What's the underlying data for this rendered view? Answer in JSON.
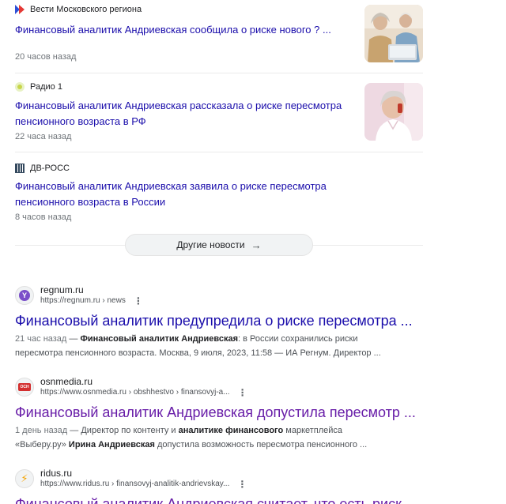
{
  "news": [
    {
      "source": "Вести Московского региона",
      "source_icon": "vesti-logo-icon",
      "title": "Финансовый аналитик Андриевская сообщила о риске нового ? ...",
      "time": "20 часов назад",
      "thumbnail": "elderly-couple-laptop-photo"
    },
    {
      "source": "Радио 1",
      "source_icon": "radio1-logo-icon",
      "title": "Финансовый аналитик Андриевская рассказала о риске пересмотра пенсионного возраста в РФ",
      "time": "22 часа назад",
      "thumbnail": "elderly-woman-phone-photo"
    },
    {
      "source": "ДВ-РОСС",
      "source_icon": "dvross-logo-icon",
      "title": "Финансовый аналитик Андриевская заявила о риске пересмотра пенсионного возраста в России",
      "time": "8 часов назад"
    }
  ],
  "more_news": {
    "label": "Другие новости",
    "icon": "arrow-right-icon"
  },
  "results": [
    {
      "site": "regnum.ru",
      "url": "https://regnum.ru › news",
      "title": "Финансовый аналитик предупредила о риске пересмотра ...",
      "date": "21 час назад",
      "dash": " — ",
      "bold1": "Финансовый аналитик Андриевская",
      "text1": ": в России сохранились риски пересмотра пенсионного возраста. Москва, 9 июля, 2023, 11:58 — ИА Регнум. Директор ..."
    },
    {
      "site": "osnmedia.ru",
      "url": "https://www.osnmedia.ru › obshhestvo › finansovyj-a...",
      "title": "Финансовый аналитик Андриевская допустила пересмотр ...",
      "date": "1 день назад",
      "dash": " — ",
      "text1": "Директор по контенту и ",
      "bold1": "аналитике финансового",
      "text2": " маркетплейса «Выберу.ру» ",
      "bold2": "Ирина Андриевская",
      "text3": " допустила возможность пересмотра пенсионного ..."
    },
    {
      "site": "ridus.ru",
      "url": "https://www.ridus.ru › finansovyj-analitik-andrievskay...",
      "title": "Финансовый аналитик Андриевская считает, что есть риск ..."
    }
  ],
  "colors": {
    "link": "#1a0dab",
    "visited": "#681da8",
    "meta": "#70757a"
  }
}
